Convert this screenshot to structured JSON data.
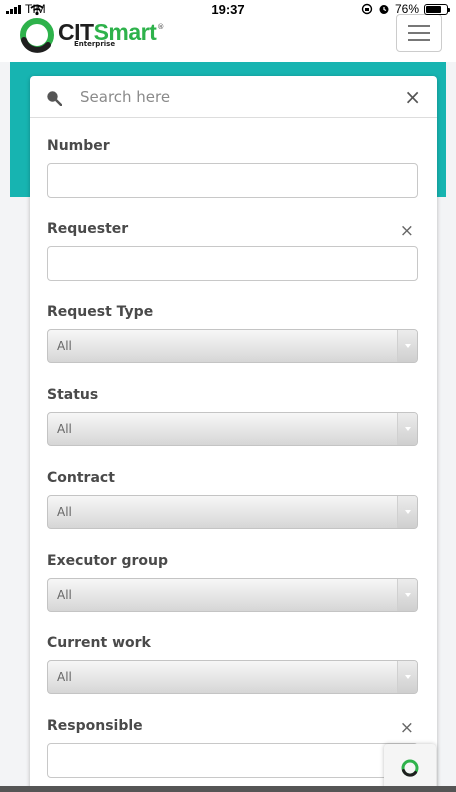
{
  "status_bar": {
    "carrier": "TIM",
    "time": "19:37",
    "battery": "76%",
    "battery_level": 0.76
  },
  "header": {
    "logo_cit": "CIT",
    "logo_smart": "Smart",
    "logo_reg": "®",
    "logo_sub": "Enterprise",
    "brand_color": "#2eb24b",
    "accent_color": "#17b4b1"
  },
  "search": {
    "placeholder": "Search here",
    "clear": "×"
  },
  "fields": {
    "number": {
      "label": "Number",
      "value": ""
    },
    "requester": {
      "label": "Requester",
      "clear": "×",
      "value": ""
    },
    "request_type": {
      "label": "Request Type",
      "value": "All"
    },
    "status": {
      "label": "Status",
      "value": "All"
    },
    "contract": {
      "label": "Contract",
      "value": "All"
    },
    "executor_group": {
      "label": "Executor group",
      "value": "All"
    },
    "current_work": {
      "label": "Current work",
      "value": "All"
    },
    "responsible": {
      "label": "Responsible",
      "clear": "×",
      "value": ""
    }
  }
}
